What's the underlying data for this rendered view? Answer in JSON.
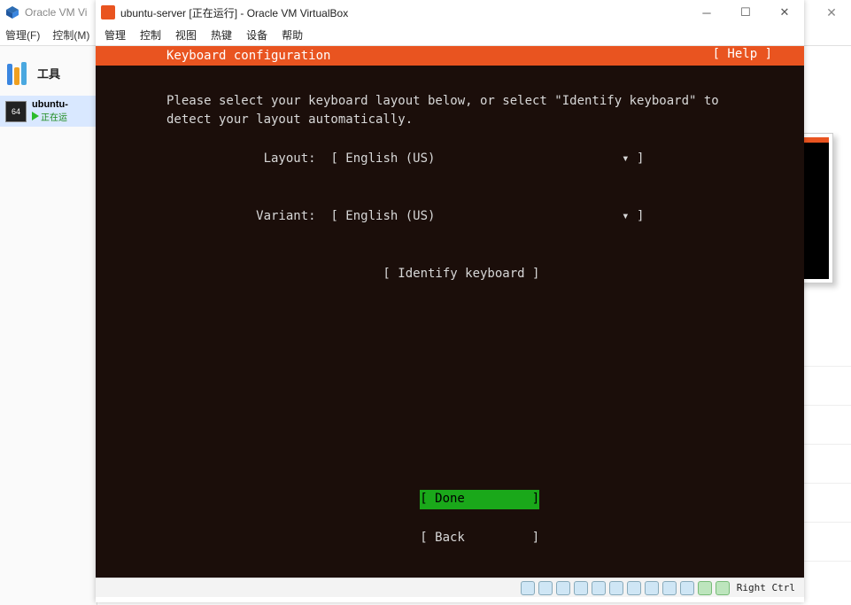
{
  "outer": {
    "title": "Oracle VM Vi",
    "menu": [
      "管理(F)",
      "控制(M)"
    ],
    "tools_label": "工具",
    "vm_name": "ubuntu-",
    "vm_state": "正在运"
  },
  "vm": {
    "title": "ubuntu-server [正在运行] - Oracle VM VirtualBox",
    "menu": [
      "管理",
      "控制",
      "视图",
      "热键",
      "设备",
      "帮助"
    ],
    "hostkey": "Right Ctrl"
  },
  "installer": {
    "header": "Keyboard configuration",
    "help": "[ Help ]",
    "instruction_l1": "Please select your keyboard layout below, or select \"Identify keyboard\" to",
    "instruction_l2": "detect your layout automatically.",
    "layout_label": "             Layout:  ",
    "layout_value": "[ English (US)                         ▾ ]",
    "variant_label": "            Variant:  ",
    "variant_value": "[ English (US)                         ▾ ]",
    "identify": "                             [ Identify keyboard ]",
    "done": "[ Done         ]",
    "back": "[ Back         ]"
  }
}
